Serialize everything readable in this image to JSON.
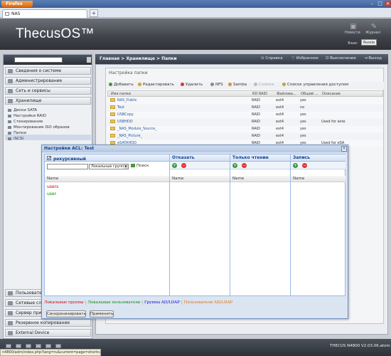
{
  "browser": {
    "menu_label": "Firefox",
    "tab_title": "NAS",
    "new_tab": "+",
    "win_min": "–",
    "win_max": "□",
    "win_close": "×"
  },
  "header": {
    "logo": "ThecusOS™",
    "news_label": "Новости",
    "journal_label": "Журнал",
    "lang_label": "Язык:",
    "lang_value": "Russia"
  },
  "nav": {
    "sections": [
      "Сведения о системе",
      "Администрирование",
      "Сеть и сервисы",
      "Хранилище"
    ],
    "storage_items": [
      "Диски SATA",
      "Настройки RAID",
      "Стекирование",
      "Монтирование ISO образов",
      "Папки",
      "iSCSI"
    ],
    "bottom_sections": [
      "Пользовате...",
      "Сетевые служ...",
      "Сервер прило...",
      "Резервное копирование",
      "External Device"
    ]
  },
  "toolstrip": {
    "breadcrumb": "Главная > Хранилище > Папки",
    "help": "Справка",
    "favorites": "Избранное",
    "shutdown": "Выключение",
    "logout": "Выход"
  },
  "folders": {
    "title": "Настройка папки",
    "toolbar": [
      "Добавить",
      "Редактировать",
      "Удалить",
      "NFS",
      "Samba",
      "Снимок",
      "Список управления доступом"
    ],
    "headers": [
      "Имя папки",
      "RD RAID",
      "Файлова...",
      "Общий ...",
      "Описание"
    ],
    "rows": [
      {
        "name": "NAS_Public",
        "raid": "RAID",
        "fs": "ext4",
        "shared": "yes",
        "desc": ""
      },
      {
        "name": "Test",
        "raid": "RAID",
        "fs": "ext4",
        "shared": "no",
        "desc": ""
      },
      {
        "name": "USBCopy",
        "raid": "RAID",
        "fs": "ext4",
        "shared": "yes",
        "desc": ""
      },
      {
        "name": "USBHDD",
        "raid": "RAID",
        "fs": "ext4",
        "shared": "yes",
        "desc": "Used for exte"
      },
      {
        "name": "_NAS_Module_Source_",
        "raid": "RAID",
        "fs": "ext4",
        "shared": "yes",
        "desc": ""
      },
      {
        "name": "_NAS_Picture_",
        "raid": "RAID",
        "fs": "ext4",
        "shared": "yes",
        "desc": ""
      },
      {
        "name": "eSATAHDD",
        "raid": "RAID",
        "fs": "ext4",
        "shared": "yes",
        "desc": "Used for eSA"
      }
    ]
  },
  "dialog": {
    "title": "Настройки ACL: Test",
    "close": "×",
    "recursive_label": "рекурсивный",
    "recursive_checked": "✔",
    "group_select": "Локальные группы",
    "search_label": "Поиск",
    "columns": [
      "Отказать",
      "Только чтение",
      "Запись"
    ],
    "name_header": "Name",
    "entries": [
      {
        "name": "users",
        "type": "group"
      },
      {
        "name": "user",
        "type": "user"
      }
    ],
    "legend": [
      {
        "label": "Локальные группы",
        "color": "#cc0000"
      },
      {
        "label": "Локальные пользователи",
        "color": "#008800"
      },
      {
        "label": "Группы AD/LDAP",
        "color": "#0000cc"
      },
      {
        "label": "Пользователи AD/LDAP",
        "color": "#e07000"
      }
    ],
    "legend_sep": "|",
    "sync_button": "Синхронизировать",
    "apply_button": "Применить"
  },
  "status": {
    "version": "THECUS N4800 V2.03.06.atom",
    "url": "n4800/adm/index.php?lang=ru&current=page=shortcut#"
  },
  "colors": {
    "accent": "#15428b",
    "header_bg": "#3f4248",
    "group_color": "#cc0000",
    "user_color": "#008800"
  }
}
